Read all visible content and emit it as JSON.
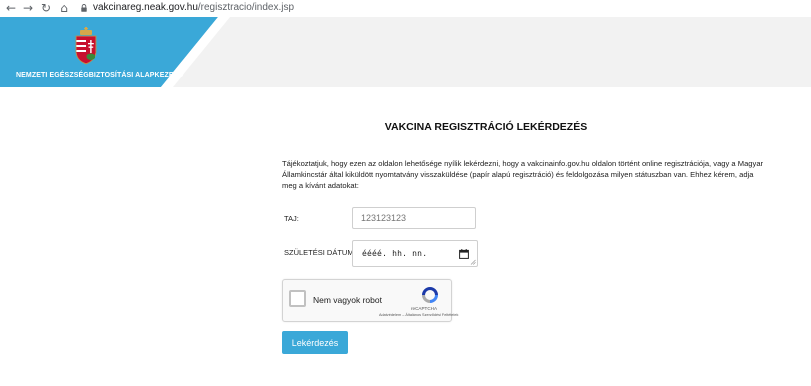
{
  "browser": {
    "back_icon": "←",
    "forward_icon": "→",
    "reload_icon": "↻",
    "home_icon": "⌂",
    "url_domain": "vakcinareg.neak.gov.hu",
    "url_path": "/regisztracio/index.jsp"
  },
  "header": {
    "org_name": "NEMZETI EGÉSZSÉGBIZTOSÍTÁSI ALAPKEZELŐ",
    "accent_color": "#3aa8d8"
  },
  "main": {
    "title": "VAKCINA REGISZTRÁCIÓ LEKÉRDEZÉS",
    "intro": "Tájékoztatjuk, hogy ezen az oldalon lehetősége nyílik lekérdezni, hogy a vakcinainfo.gov.hu oldalon történt online regisztrációja, vagy a Magyar Államkincstár által kiküldött nyomtatvány visszaküldése (papír alapú regisztráció) és feldolgozása milyen státuszban van. Ehhez kérem, adja meg a kívánt adatokat:"
  },
  "form": {
    "taj_label": "TAJ:",
    "taj_placeholder": "123123123",
    "dob_label": "SZÜLETÉSI DÁTUM:",
    "dob_value": "éééé. hh. nn.",
    "submit_label": "Lekérdezés"
  },
  "recaptcha": {
    "label": "Nem vagyok robot",
    "brand": "reCAPTCHA",
    "links": "Adatvédelem – Általános Szerződési Feltételek"
  }
}
